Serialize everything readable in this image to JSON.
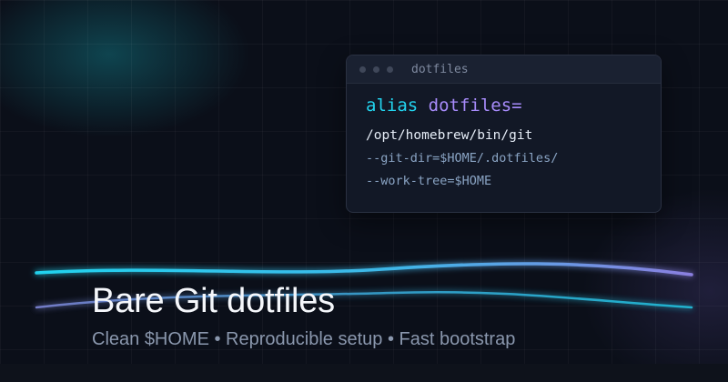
{
  "terminal": {
    "title": "dotfiles",
    "command_keyword": "alias",
    "command_name": "dotfiles=",
    "path": "/opt/homebrew/bin/git",
    "flag_git_dir": "--git-dir=$HOME/.dotfiles/",
    "flag_work_tree": "--work-tree=$HOME"
  },
  "headline": "Bare Git dotfiles",
  "subtitle": "Clean $HOME • Reproducible setup • Fast bootstrap",
  "colors": {
    "background": "#0b0f19",
    "accent_cyan": "#22d3ee",
    "accent_violet": "#a78bfa"
  }
}
